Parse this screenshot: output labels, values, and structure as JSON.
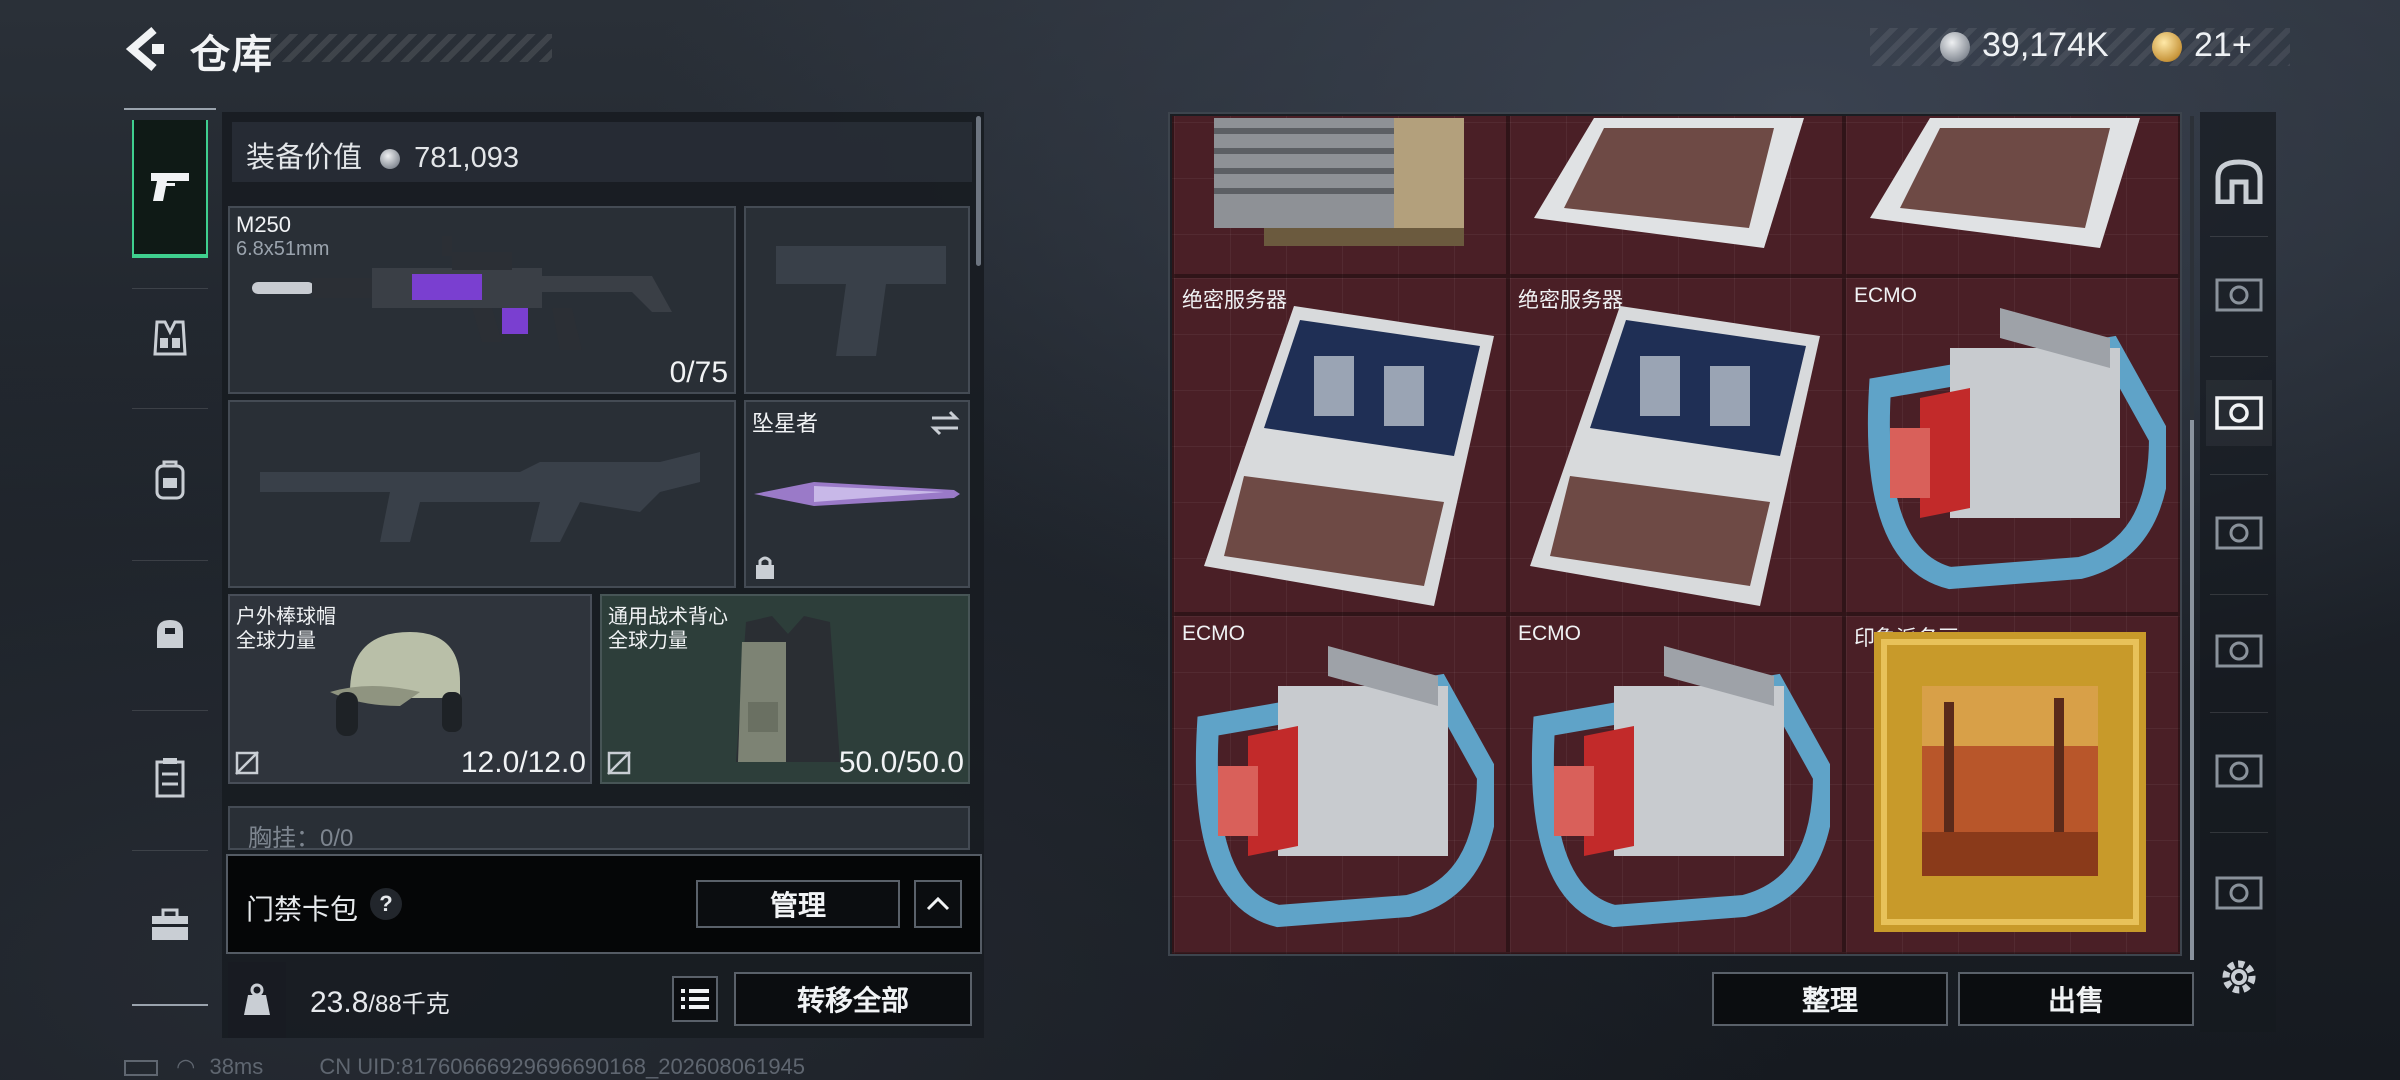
{
  "header": {
    "title": "仓库",
    "currency_silver": "39,174K",
    "currency_gold": "21+"
  },
  "colors": {
    "accent": "#3fcf8e",
    "stash_cell": "#4a1f26"
  },
  "left_tabs": [
    {
      "icon": "pistol-icon",
      "active": true
    },
    {
      "icon": "vest-icon",
      "active": false
    },
    {
      "icon": "backpack-icon",
      "active": false
    },
    {
      "icon": "helmet-bag-icon",
      "active": false
    },
    {
      "icon": "locker-icon",
      "active": false
    },
    {
      "icon": "toolbox-icon",
      "active": false
    }
  ],
  "equipment": {
    "value_label": "装备价值",
    "value": "781,093",
    "primary": {
      "name": "M250",
      "caliber": "6.8x51mm",
      "ammo": "0/75"
    },
    "melee": {
      "name": "坠星者"
    },
    "helmet": {
      "name": "户外棒球帽",
      "sub": "全球力量",
      "durability": "12.0/12.0"
    },
    "armor": {
      "name": "通用战术背心",
      "sub": "全球力量",
      "durability": "50.0/50.0"
    },
    "cut_off_row": "胸挂：0/0",
    "card_pack": {
      "label": "门禁卡包",
      "help": "?",
      "manage_label": "管理"
    },
    "weight": "23.8",
    "weight_max": "/88千克",
    "transfer_all_label": "转移全部"
  },
  "stash": {
    "items": [
      {
        "label": "",
        "kind": "server-rack-top"
      },
      {
        "label": "",
        "kind": "server-top"
      },
      {
        "label": "",
        "kind": "server-top"
      },
      {
        "label": "绝密服务器",
        "kind": "server"
      },
      {
        "label": "绝密服务器",
        "kind": "server"
      },
      {
        "label": "ECMO",
        "kind": "ecmo"
      },
      {
        "label": "ECMO",
        "kind": "ecmo"
      },
      {
        "label": "ECMO",
        "kind": "ecmo"
      },
      {
        "label": "印象派名画",
        "kind": "painting"
      }
    ],
    "sort_label": "整理",
    "sell_label": "出售"
  },
  "right_rail": [
    "home-icon",
    "safe-icon",
    "safe-icon",
    "safe-icon",
    "safe-icon",
    "safe-icon",
    "safe-icon"
  ],
  "footer": {
    "ping": "38ms",
    "uid": "CN UID:81760666929696690168_202608061945"
  }
}
